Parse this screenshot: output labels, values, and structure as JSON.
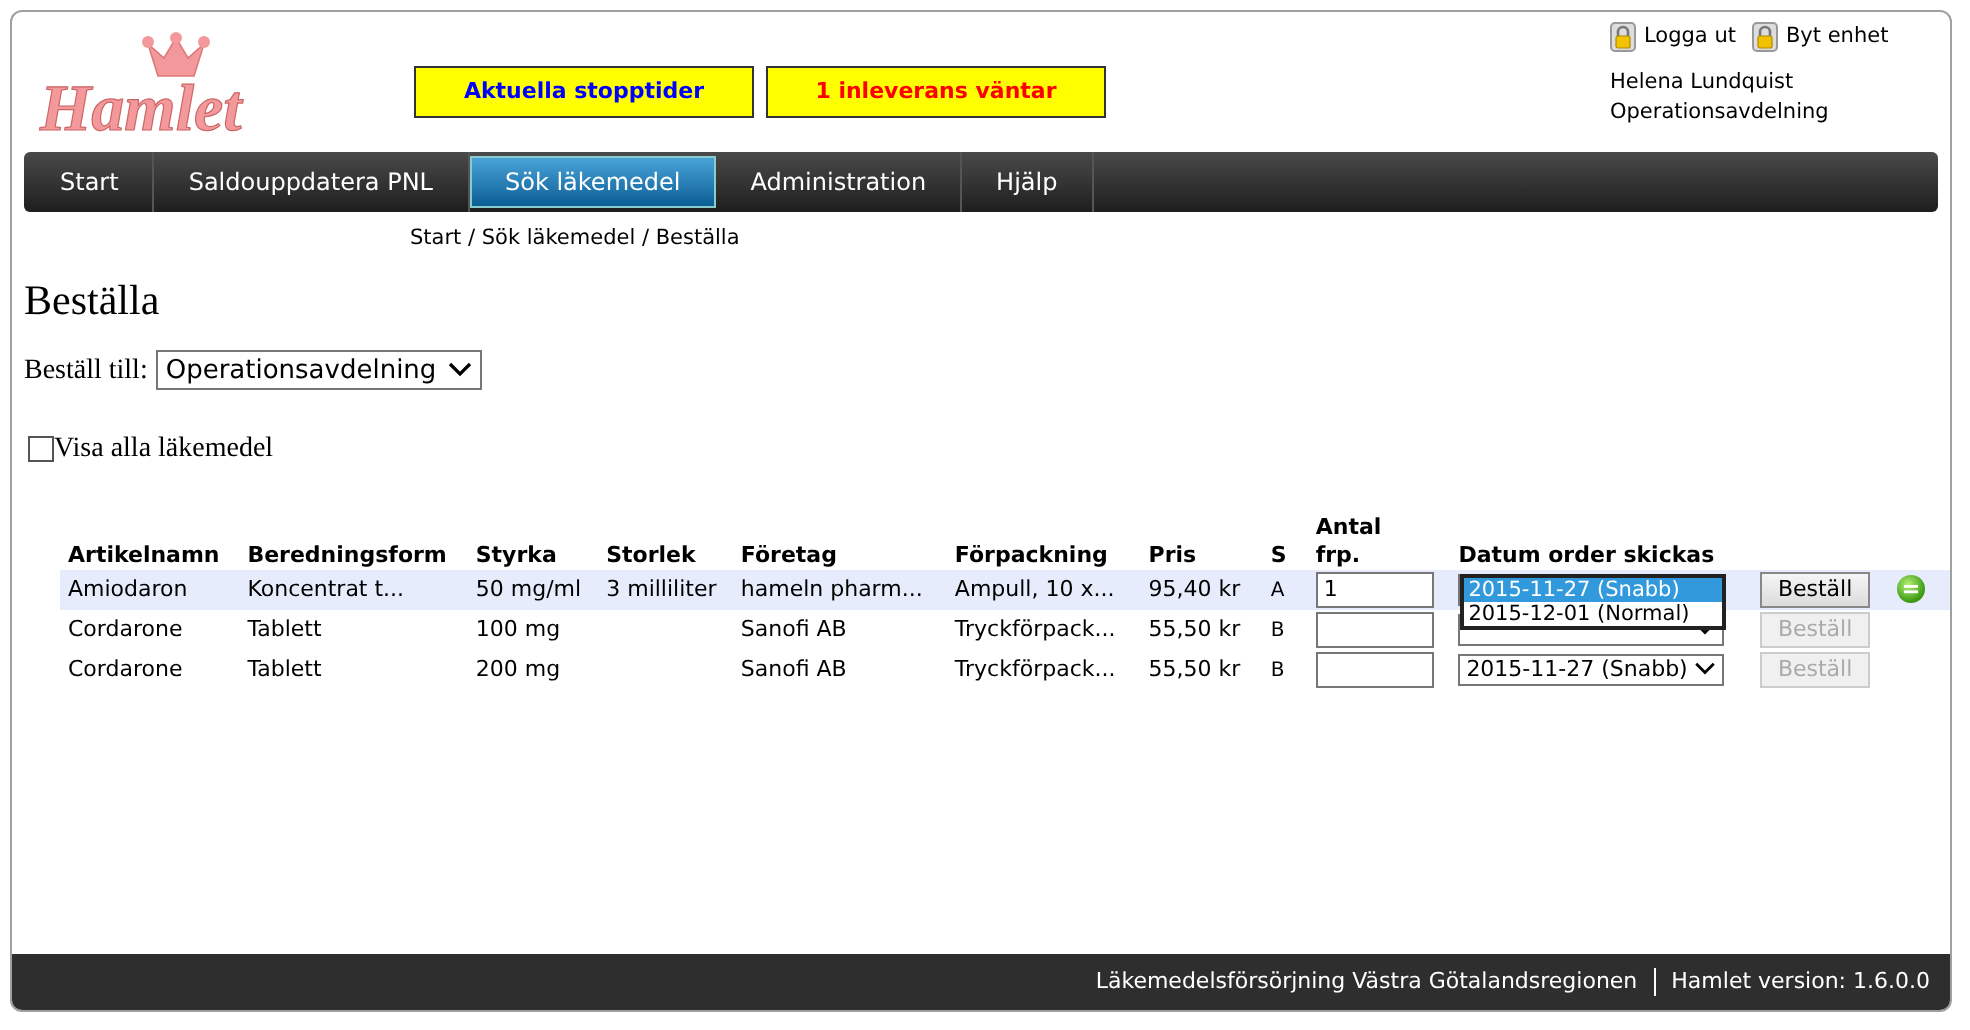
{
  "header": {
    "logo": "Hamlet",
    "notices": [
      {
        "text": "Aktuella stopptider",
        "kind": "info"
      },
      {
        "text": "1 inleverans väntar",
        "kind": "alert"
      }
    ],
    "links": [
      "Logga ut",
      "Byt enhet"
    ],
    "user": "Helena Lundquist",
    "unit": "Operationsavdelning"
  },
  "nav": [
    {
      "label": "Start",
      "selected": false
    },
    {
      "label": "Saldouppdatera PNL",
      "selected": false
    },
    {
      "label": "Sök läkemedel",
      "selected": true
    },
    {
      "label": "Administration",
      "selected": false
    },
    {
      "label": "Hjälp",
      "selected": false
    }
  ],
  "breadcrumb": "Start / Sök läkemedel / Beställa",
  "title": "Beställa",
  "order_to": {
    "label": "Beställ till:",
    "value": "Operationsavdelning"
  },
  "show_all": {
    "label": "Visa alla läkemedel",
    "checked": false
  },
  "table": {
    "columns": [
      "Artikelnamn",
      "Beredningsform",
      "Styrka",
      "Storlek",
      "Företag",
      "Förpackning",
      "Pris",
      "S",
      "Antal frp.",
      "Datum order skickas"
    ],
    "rows": [
      {
        "selected": true,
        "cells": [
          "Amiodaron",
          "Koncentrat t...",
          "50 mg/ml",
          "3 milliliter",
          "hameln pharm...",
          "Ampull, 10 x...",
          "95,40 kr",
          "A"
        ],
        "quantity": "1",
        "date": {
          "open": true,
          "options": [
            {
              "label": "2015-11-27 (Snabb)",
              "selected": true
            },
            {
              "label": "2015-12-01 (Normal)",
              "selected": false
            }
          ]
        },
        "button": {
          "label": "Beställ",
          "disabled": false
        },
        "indicator": true
      },
      {
        "selected": false,
        "cells": [
          "Cordarone",
          "Tablett",
          "100 mg",
          "",
          "Sanofi AB",
          "Tryckförpack...",
          "55,50 kr",
          "B"
        ],
        "quantity": "",
        "date": {
          "open": false
        },
        "button": {
          "label": "Beställ",
          "disabled": true
        },
        "indicator": false
      },
      {
        "selected": false,
        "cells": [
          "Cordarone",
          "Tablett",
          "200 mg",
          "",
          "Sanofi AB",
          "Tryckförpack...",
          "55,50 kr",
          "B"
        ],
        "quantity": "",
        "date": {
          "open": false,
          "value": "2015-11-27 (Snabb)"
        },
        "button": {
          "label": "Beställ",
          "disabled": true
        },
        "indicator": false
      }
    ]
  },
  "footer": {
    "org": "Läkemedelsförsörjning Västra Götalandsregionen",
    "version": "Hamlet version: 1.6.0.0"
  }
}
